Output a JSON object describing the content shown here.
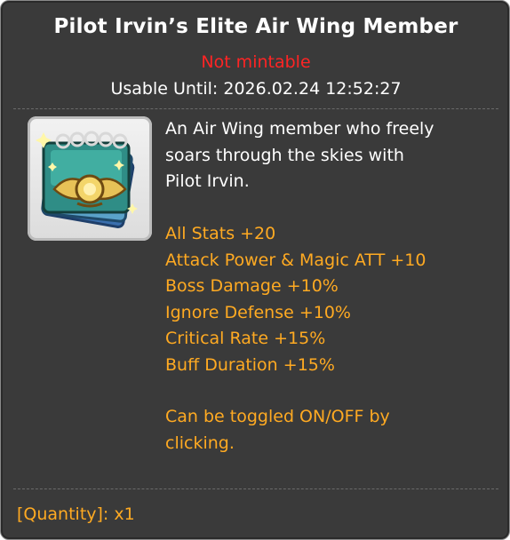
{
  "item": {
    "title": "Pilot Irvin’s Elite Air Wing Member",
    "mint_status": "Not mintable",
    "usable_until": "Usable Until: 2026.02.24 12:52:27",
    "icon": "air-wing-badge-icon",
    "description": "An Air Wing member who freely\nsoars through the skies with\nPilot Irvin.",
    "effects": [
      "All Stats +20",
      "Attack Power & Magic ATT +10",
      "Boss Damage +10%",
      "Ignore Defense +10%",
      "Critical Rate +15%",
      "Buff Duration +15%"
    ],
    "toggle_note": "Can be toggled ON/OFF by clicking.",
    "quantity": "[Quantity]: x1"
  },
  "colors": {
    "background": "#3a3a3a",
    "title": "#ffffff",
    "not_mintable": "#ff2424",
    "effect_text": "#ffaa22"
  }
}
